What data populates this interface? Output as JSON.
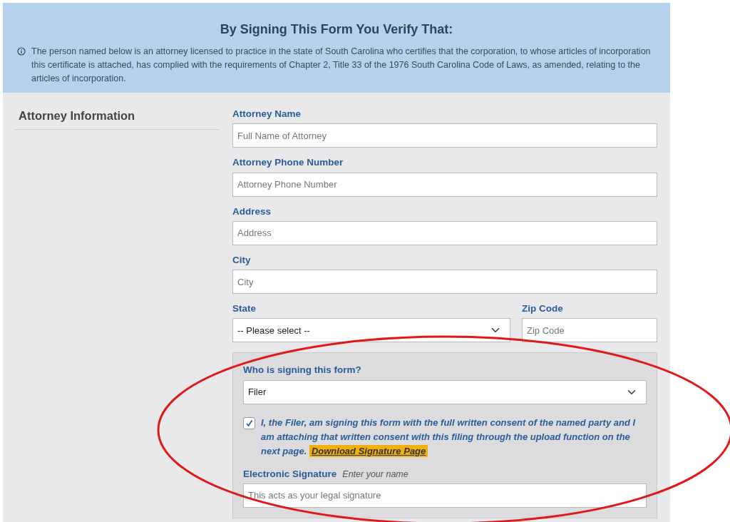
{
  "banner": {
    "title": "By Signing This Form You Verify That:",
    "text": "The person named below is an attorney licensed to practice in the state of South Carolina who certifies that the corporation, to whose articles of incorporation this certificate is attached, has complied with the requirements of Chapter 2, Title 33 of the 1976 South Carolina Code of Laws, as amended, relating to the articles of incorporation."
  },
  "section": {
    "title": "Attorney Information"
  },
  "fields": [
    {
      "label": "Attorney Name",
      "placeholder": "Full Name of Attorney"
    },
    {
      "label": "Attorney Phone Number",
      "placeholder": "Attorney Phone Number"
    },
    {
      "label": "Address",
      "placeholder": "Address"
    },
    {
      "label": "City",
      "placeholder": "City"
    }
  ],
  "address_row": [
    {
      "kind": "select",
      "label": "State",
      "value": "-- Please select --"
    },
    {
      "kind": "text",
      "label": "Zip Code",
      "placeholder": "Zip Code"
    }
  ],
  "signing": {
    "label": "Who is signing this form?",
    "value": "Filer",
    "consent": {
      "checked": true,
      "text": "I, the Filer, am signing this form with the full written consent of the named party and I am attaching that written consent with this filing through the upload function on the next page.",
      "link": "Download Signature Page"
    },
    "signature": {
      "label": "Electronic Signature",
      "hint": "Enter your name",
      "placeholder": "This acts as your legal signature"
    }
  },
  "annotation": {
    "kind": "ellipse"
  }
}
